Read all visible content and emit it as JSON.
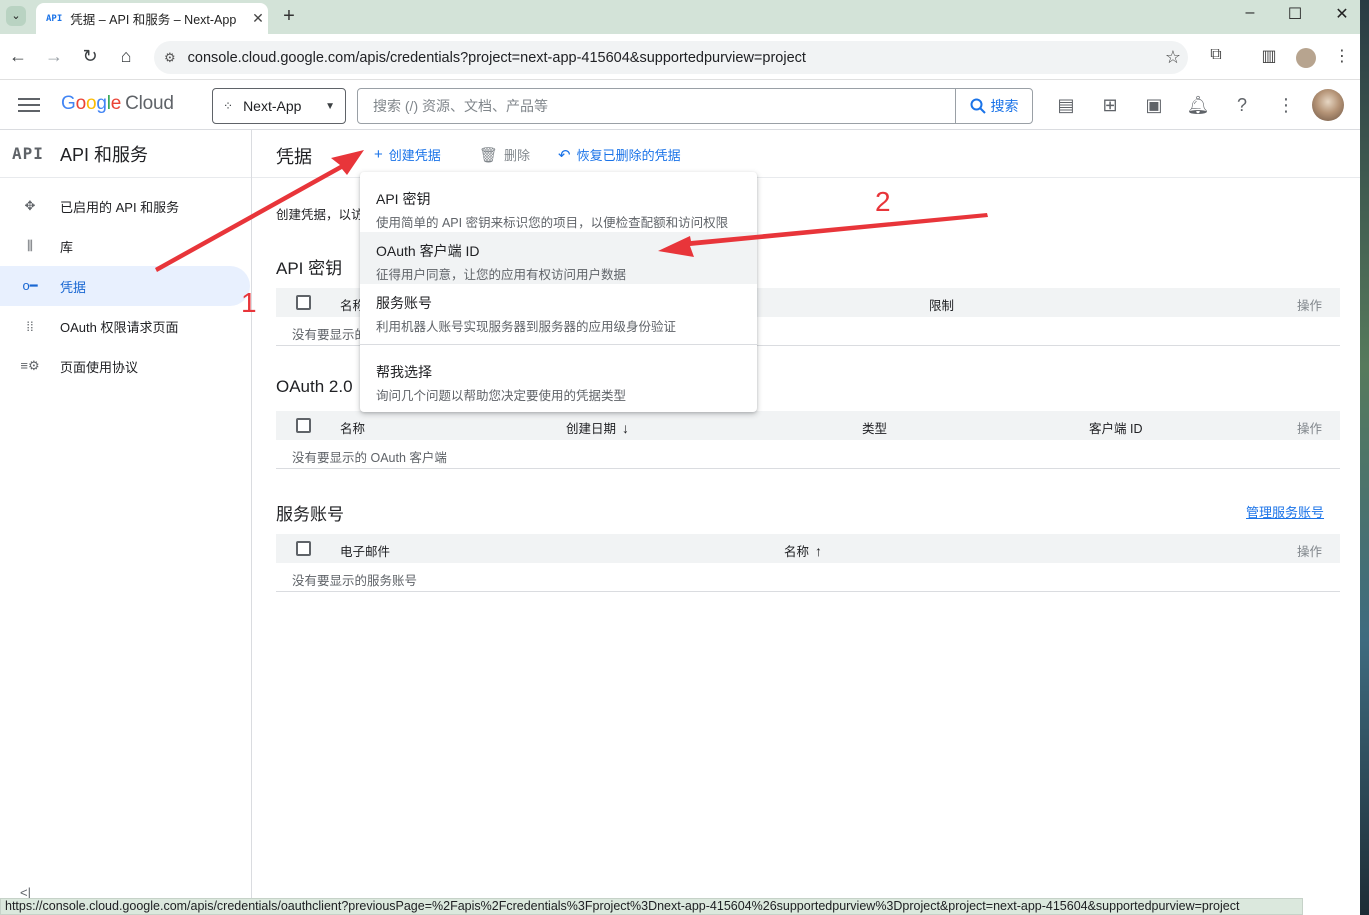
{
  "browser": {
    "tab_title": "凭据 – API 和服务 – Next-App",
    "tab_favicon": "API",
    "url": "console.cloud.google.com/apis/credentials?project=next-app-415604&supportedpurview=project",
    "status_url": "https://console.cloud.google.com/apis/credentials/oauthclient?previousPage=%2Fapis%2Fcredentials%3Fproject%3Dnext-app-415604%26supportedpurview%3Dproject&project=next-app-415604&supportedpurview=project"
  },
  "header": {
    "logo_parts": [
      "G",
      "o",
      "o",
      "g",
      "l",
      "e"
    ],
    "logo_cloud": "Cloud",
    "project": "Next-App",
    "search_placeholder": "搜索 (/) 资源、文档、产品等",
    "search_button": "搜索"
  },
  "leftnav": {
    "section_icon": "API",
    "section_title": "API 和服务",
    "items": [
      {
        "label": "已启用的 API 和服务",
        "icon": "diamond-dots-icon"
      },
      {
        "label": "库",
        "icon": "library-icon"
      },
      {
        "label": "凭据",
        "icon": "key-icon"
      },
      {
        "label": "OAuth 权限请求页面",
        "icon": "dots-grid-icon"
      },
      {
        "label": "页面使用协议",
        "icon": "settings-list-icon"
      }
    ]
  },
  "toolbar": {
    "title": "凭据",
    "create_label": "创建凭据",
    "delete_label": "删除",
    "restore_label": "恢复已删除的凭据"
  },
  "intro_text": "创建凭据，以访",
  "api_keys": {
    "title": "API 密钥",
    "columns": [
      "名称",
      "限制",
      "操作"
    ],
    "empty": "没有要显示的"
  },
  "oauth": {
    "title": "OAuth 2.0",
    "columns": [
      "名称",
      "创建日期",
      "类型",
      "客户端 ID",
      "操作"
    ],
    "empty": "没有要显示的 OAuth 客户端"
  },
  "service_accounts": {
    "title": "服务账号",
    "manage_link": "管理服务账号",
    "columns": [
      "电子邮件",
      "名称",
      "操作"
    ],
    "empty": "没有要显示的服务账号"
  },
  "menu": {
    "items": [
      {
        "title": "API 密钥",
        "desc": "使用简单的 API 密钥来标识您的项目，以便检查配额和访问权限"
      },
      {
        "title": "OAuth 客户端 ID",
        "desc": "征得用户同意，让您的应用有权访问用户数据"
      },
      {
        "title": "服务账号",
        "desc": "利用机器人账号实现服务器到服务器的应用级身份验证"
      },
      {
        "title": "帮我选择",
        "desc": "询问几个问题以帮助您决定要使用的凭据类型"
      }
    ]
  },
  "annotations": {
    "label_1": "1",
    "label_2": "2",
    "arrow_color": "#e8353a"
  }
}
